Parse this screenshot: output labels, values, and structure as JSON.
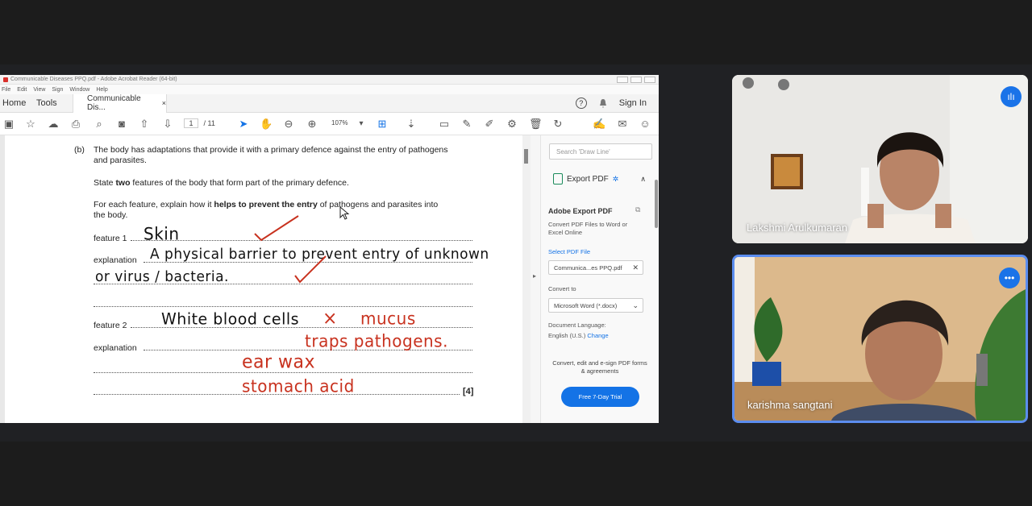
{
  "acrobat": {
    "title": "Communicable Diseases PPQ.pdf - Adobe Acrobat Reader (64-bit)",
    "menu": [
      "File",
      "Edit",
      "View",
      "Sign",
      "Window",
      "Help"
    ],
    "tabs": {
      "home": "Home",
      "tools": "Tools",
      "document": "Communicable Dis...",
      "close": "×"
    },
    "help_icon": "?",
    "sign_in": "Sign In",
    "page_current": "1",
    "page_total": "/ 11",
    "zoom": "107%"
  },
  "document": {
    "part": "(b)",
    "q1": "The body has adaptations that provide it with a primary defence against the entry of pathogens",
    "q1b": "and parasites.",
    "q2_pre": "State ",
    "q2_bold": "two",
    "q2_post": " features of the body that form part of the primary defence.",
    "q3_pre": "For each feature, explain how it ",
    "q3_bold": "helps to prevent the entry",
    "q3_post": " of pathogens and parasites into",
    "q3b": "the body.",
    "feature1_label": "feature 1",
    "explanation1_label": "explanation",
    "feature2_label": "feature 2",
    "explanation2_label": "explanation",
    "marks": "[4]",
    "hw_feature1": "Skin",
    "hw_expl1a": "A physical barrier to prevent entry of unknown",
    "hw_expl1b": "or virus / bacteria.",
    "hw_feature2": "White blood cells",
    "hw_x": "×",
    "hw_mucus": "mucus",
    "hw_traps": "traps pathogens.",
    "hw_earwax": "ear wax",
    "hw_stomach": "stomach acid"
  },
  "right_pane": {
    "search_placeholder": "Search 'Draw Line'",
    "export_title": "Export PDF",
    "heading": "Adobe Export PDF",
    "description": "Convert PDF Files to Word or Excel Online",
    "select_label": "Select PDF File",
    "selected_file": "Communica...es PPQ.pdf",
    "convert_label": "Convert to",
    "convert_value": "Microsoft Word (*.docx)",
    "doc_lang_label": "Document Language:",
    "doc_lang_value": "English (U.S.)",
    "change_link": "Change",
    "convert_text": "Convert, edit and e-sign PDF forms & agreements",
    "trial_button": "Free 7-Day Trial"
  },
  "participants": [
    {
      "name": "Lakshmi Arulkumaran"
    },
    {
      "name": "karishma sangtani"
    }
  ]
}
